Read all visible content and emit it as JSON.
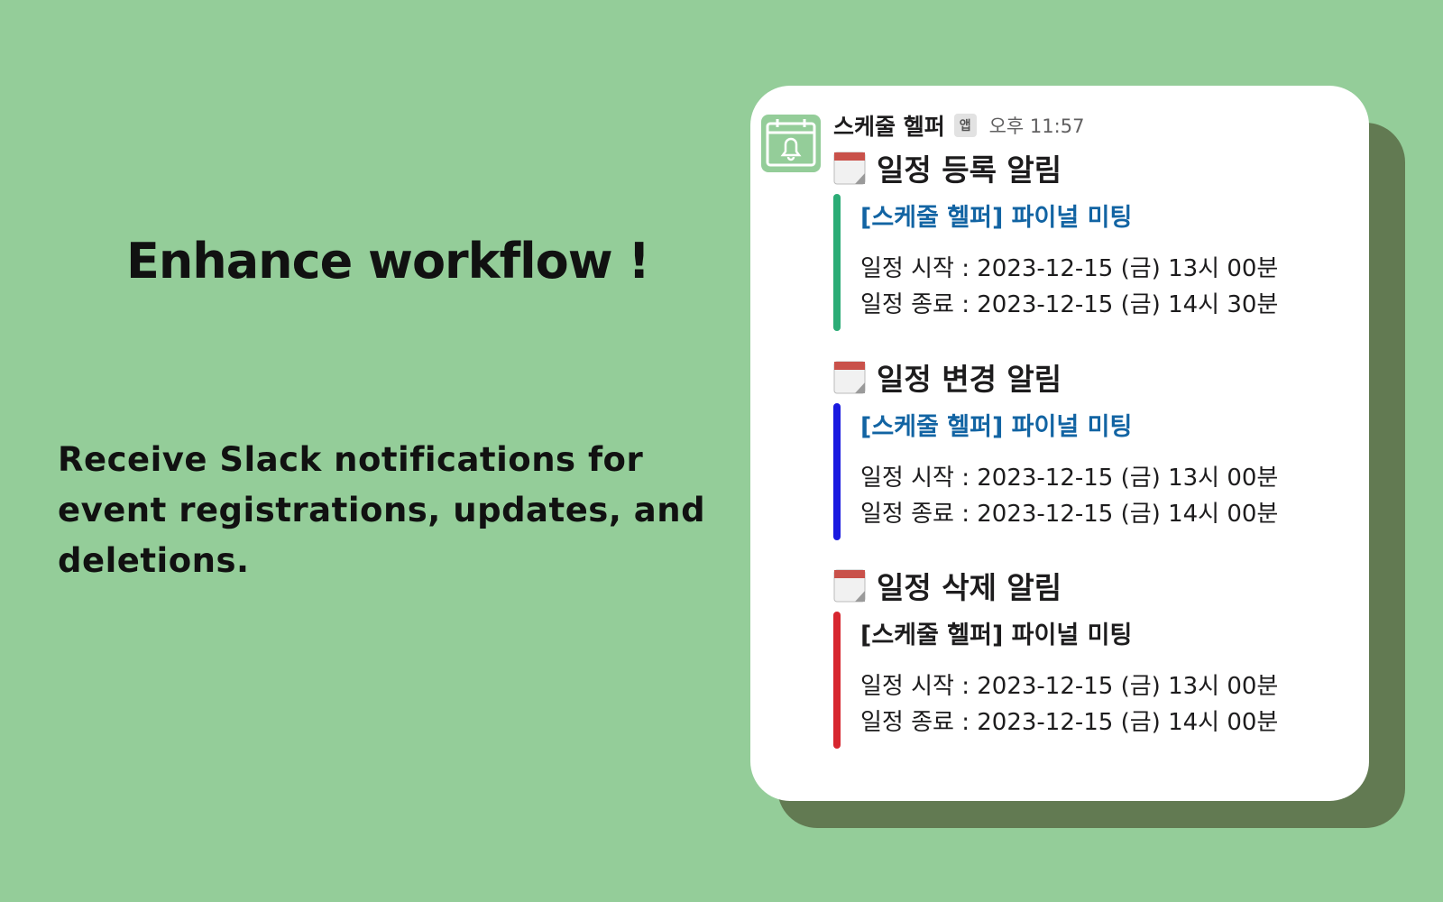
{
  "hero": {
    "headline": "Enhance workflow !",
    "description": "Receive Slack notifications for event registrations, updates, and deletions."
  },
  "message": {
    "app_name": "스케줄 헬퍼",
    "app_badge": "앱",
    "timestamp": "오후 11:57",
    "avatar_icon": "calendar-bell-icon",
    "sections": [
      {
        "title": "일정 등록 알림",
        "icon": "calendar-icon",
        "bar_color": "#2bac76",
        "event_title": "[스케줄 헬퍼] 파이널 미팅",
        "event_title_color": "#1264a3",
        "start": "일정 시작 : 2023-12-15 (금) 13시 00분",
        "end": "일정 종료 : 2023-12-15 (금) 14시 30분"
      },
      {
        "title": "일정 변경 알림",
        "icon": "calendar-icon",
        "bar_color": "#1a1ae0",
        "event_title": "[스케줄 헬퍼] 파이널 미팅",
        "event_title_color": "#1264a3",
        "start": "일정 시작 : 2023-12-15 (금) 13시 00분",
        "end": "일정 종료 : 2023-12-15 (금) 14시 00분"
      },
      {
        "title": "일정 삭제 알림",
        "icon": "calendar-icon",
        "bar_color": "#d7262f",
        "event_title": "[스케줄 헬퍼] 파이널 미팅",
        "event_title_color": "#1d1c1d",
        "start": "일정 시작 : 2023-12-15 (금) 13시 00분",
        "end": "일정 종료 : 2023-12-15 (금) 14시 00분"
      }
    ]
  }
}
